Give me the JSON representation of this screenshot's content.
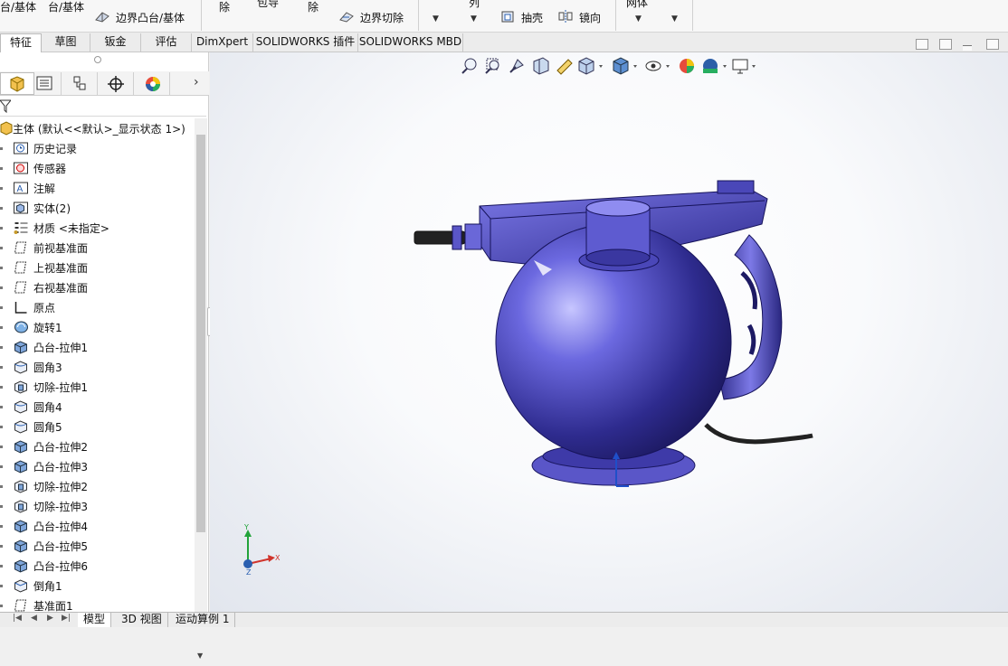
{
  "ribbon": {
    "boss_base_cut": "台/基体",
    "boss_base": "台/基体",
    "boundary_boss": "边界凸台/基体",
    "remove1": "除",
    "wrap": "包导",
    "remove2": "除",
    "boundary_cut": "边界切除",
    "array": "列",
    "shell": "抽壳",
    "mirror": "镜向",
    "body": "网体"
  },
  "tabs": [
    "特征",
    "草图",
    "钣金",
    "评估",
    "DimXpert",
    "SOLIDWORKS 插件",
    "SOLIDWORKS MBD"
  ],
  "feature_tree": {
    "root": "主体 (默认<<默认>_显示状态 1>)",
    "items": [
      {
        "label": "历史记录",
        "icon": "history-icon"
      },
      {
        "label": "传感器",
        "icon": "sensor-icon"
      },
      {
        "label": "注解",
        "icon": "annotation-icon"
      },
      {
        "label": "实体(2)",
        "icon": "solid-bodies-icon"
      },
      {
        "label": "材质 <未指定>",
        "icon": "material-icon"
      },
      {
        "label": "前视基准面",
        "icon": "plane-icon"
      },
      {
        "label": "上视基准面",
        "icon": "plane-icon"
      },
      {
        "label": "右视基准面",
        "icon": "plane-icon"
      },
      {
        "label": "原点",
        "icon": "origin-icon"
      },
      {
        "label": "旋转1",
        "icon": "revolve-icon"
      },
      {
        "label": "凸台-拉伸1",
        "icon": "extrude-icon"
      },
      {
        "label": "圆角3",
        "icon": "fillet-icon"
      },
      {
        "label": "切除-拉伸1",
        "icon": "cut-extrude-icon"
      },
      {
        "label": "圆角4",
        "icon": "fillet-icon"
      },
      {
        "label": "圆角5",
        "icon": "fillet-icon"
      },
      {
        "label": "凸台-拉伸2",
        "icon": "extrude-icon"
      },
      {
        "label": "凸台-拉伸3",
        "icon": "extrude-icon"
      },
      {
        "label": "切除-拉伸2",
        "icon": "cut-extrude-icon"
      },
      {
        "label": "切除-拉伸3",
        "icon": "cut-extrude-icon"
      },
      {
        "label": "凸台-拉伸4",
        "icon": "extrude-icon"
      },
      {
        "label": "凸台-拉伸5",
        "icon": "extrude-icon"
      },
      {
        "label": "凸台-拉伸6",
        "icon": "extrude-icon"
      },
      {
        "label": "倒角1",
        "icon": "chamfer-icon"
      },
      {
        "label": "基准面1",
        "icon": "plane-icon"
      }
    ]
  },
  "bottom_tabs": [
    "模型",
    "3D 视图",
    "运动算例 1"
  ],
  "triad": {
    "y": "Y",
    "x": "X",
    "z": "Z"
  },
  "colors": {
    "model": "#5a56c8",
    "accent_red": "#c0392b",
    "accent_blue": "#2a5fb0"
  }
}
